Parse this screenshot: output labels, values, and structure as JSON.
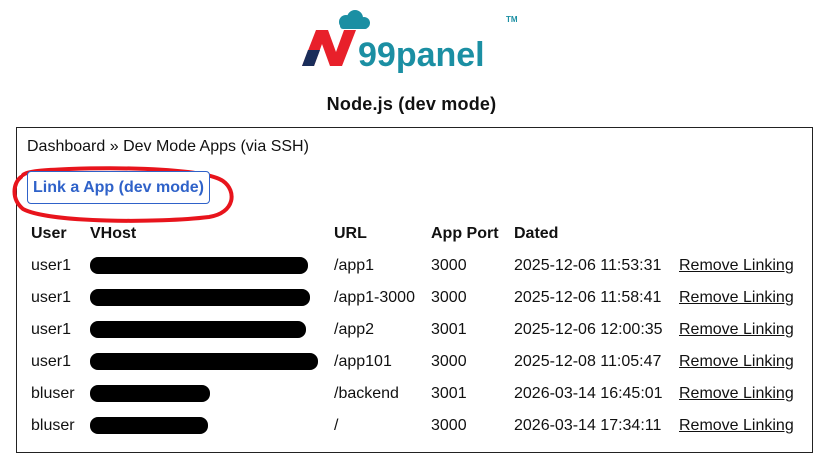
{
  "brand": {
    "logo_text": "99panel",
    "tm": "TM"
  },
  "page_title": "Node.js (dev mode)",
  "breadcrumb": "Dashboard » Dev Mode Apps (via SSH)",
  "link_button_label": "Link a App (dev mode)",
  "table": {
    "headers": [
      "User",
      "VHost",
      "URL",
      "App Port",
      "Dated"
    ],
    "rows": [
      {
        "user": "user1",
        "vhost": "",
        "url": "/app1",
        "port": "3000",
        "dated": "2025-12-06 11:53:31",
        "action": "Remove Linking"
      },
      {
        "user": "user1",
        "vhost": "",
        "url": "/app1-3000",
        "port": "3000",
        "dated": "2025-12-06 11:58:41",
        "action": "Remove Linking"
      },
      {
        "user": "user1",
        "vhost": "",
        "url": "/app2",
        "port": "3001",
        "dated": "2025-12-06 12:00:35",
        "action": "Remove Linking"
      },
      {
        "user": "user1",
        "vhost": "",
        "url": "/app101",
        "port": "3000",
        "dated": "2025-12-08 11:05:47",
        "action": "Remove Linking"
      },
      {
        "user": "bluser",
        "vhost": "",
        "url": "/backend",
        "port": "3001",
        "dated": "2026-03-14 16:45:01",
        "action": "Remove Linking"
      },
      {
        "user": "bluser",
        "vhost": "",
        "url": "/",
        "port": "3000",
        "dated": "2026-03-14 17:34:11",
        "action": "Remove Linking"
      }
    ]
  },
  "colors": {
    "link_blue": "#2f62c9",
    "annotation_red": "#e8141c",
    "logo_red": "#e8202a",
    "logo_teal": "#1b8fa3",
    "redaction": "#000000"
  },
  "icons": {
    "logo_cloud": "cloud-icon"
  }
}
